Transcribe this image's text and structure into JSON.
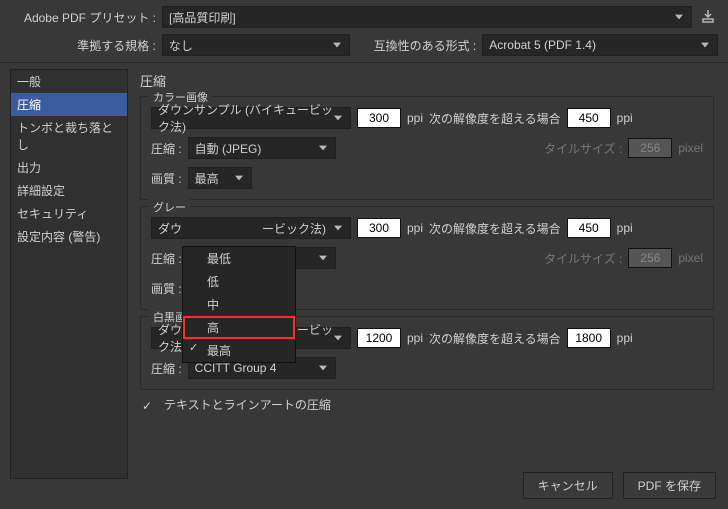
{
  "header": {
    "preset_label": "Adobe PDF プリセット :",
    "preset_value": "[高品質印刷]",
    "standard_label": "準拠する規格 :",
    "standard_value": "なし",
    "compat_label": "互換性のある形式 :",
    "compat_value": "Acrobat 5 (PDF 1.4)"
  },
  "sidebar": {
    "items": [
      {
        "label": "一般"
      },
      {
        "label": "圧縮"
      },
      {
        "label": "トンボと裁ち落とし"
      },
      {
        "label": "出力"
      },
      {
        "label": "詳細設定"
      },
      {
        "label": "セキュリティ"
      },
      {
        "label": "設定内容 (警告)"
      }
    ],
    "active_index": 1
  },
  "content": {
    "section_title": "圧縮",
    "color": {
      "title": "カラー画像",
      "downsample_method": "ダウンサンプル (バイキュービック法)",
      "ppi_value": "300",
      "ppi_unit": "ppi",
      "threshold_label": "次の解像度を超える場合",
      "threshold_value": "450",
      "threshold_unit": "ppi",
      "compress_label": "圧縮 :",
      "compress_value": "自動 (JPEG)",
      "tile_label": "タイルサイズ :",
      "tile_value": "256",
      "tile_unit": "pixel",
      "quality_label": "画質 :",
      "quality_value": "最高"
    },
    "gray": {
      "title": "グレー",
      "downsample_method_prefix": "ダウ",
      "downsample_method_suffix": "ービック法)",
      "ppi_value": "300",
      "ppi_unit": "ppi",
      "threshold_label": "次の解像度を超える場合",
      "threshold_value": "450",
      "threshold_unit": "ppi",
      "compress_label": "圧縮 :",
      "quality_label": "画質 :",
      "quality_value": "最高",
      "tile_label": "タイルサイズ :",
      "tile_value": "256",
      "tile_unit": "pixel"
    },
    "mono": {
      "title": "白黒画像",
      "downsample_method": "ダウンサンプル (バイキュービック法)",
      "ppi_value": "1200",
      "ppi_unit": "ppi",
      "threshold_label": "次の解像度を超える場合",
      "threshold_value": "1800",
      "threshold_unit": "ppi",
      "compress_label": "圧縮 :",
      "compress_value": "CCITT Group 4"
    },
    "text_compress_label": "テキストとラインアートの圧縮"
  },
  "quality_menu": {
    "items": [
      "最低",
      "低",
      "中",
      "高",
      "最高"
    ],
    "selected_index": 4,
    "highlight_index": 3
  },
  "footer": {
    "cancel": "キャンセル",
    "save": "PDF を保存"
  }
}
